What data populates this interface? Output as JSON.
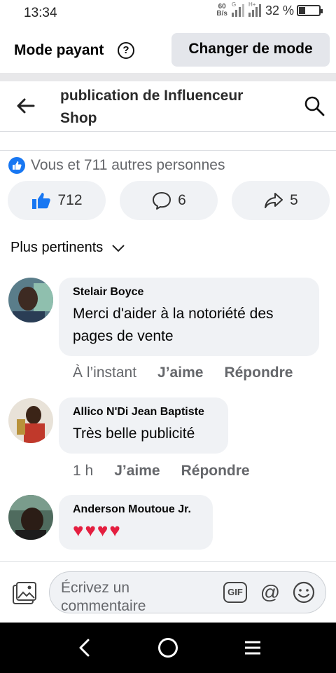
{
  "status_bar": {
    "time": "13:34",
    "net_speed_value": "60",
    "net_speed_unit": "B/s",
    "signal1_type": "G",
    "signal2_type": "H+",
    "battery_percent": "32 %",
    "battery_level": 0.32
  },
  "mode_bar": {
    "label": "Mode payant",
    "help_symbol": "?",
    "change_button": "Changer de mode"
  },
  "header": {
    "title_line1": "publication de Influenceur",
    "title_line2": "Shop",
    "back_icon": "arrow-left-icon",
    "search_icon": "search-icon"
  },
  "post": {
    "reactions_text": "Vous et 711 autres personnes",
    "like_count": "712",
    "comment_count": "6",
    "share_count": "5",
    "accent_color": "#1877f2"
  },
  "sort": {
    "label": "Plus pertinents"
  },
  "comments": [
    {
      "name": "Stelair Boyce",
      "text_line1": "Merci d'aider à la notoriété des",
      "text_line2": "pages de vente",
      "time": "À l’instant",
      "like": "J’aime",
      "reply": "Répondre"
    },
    {
      "name": "Allico N'Di Jean Baptiste",
      "text_line1": "Très belle publicité",
      "time": "1 h",
      "like": "J’aime",
      "reply": "Répondre"
    },
    {
      "name": "Anderson Moutoue Jr.",
      "text_line1": "♥♥♥♥"
    }
  ],
  "composer": {
    "placeholder": "Écrivez un commentaire",
    "gif_label": "GIF",
    "at_symbol": "@"
  }
}
